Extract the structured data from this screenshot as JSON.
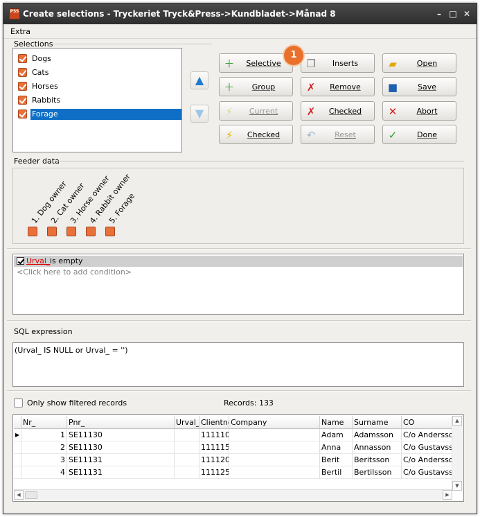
{
  "window": {
    "title": "Create selections - Tryckeriet Tryck&Press->Kundbladet->Månad 8",
    "icon": "pss-app-icon",
    "minimize": "–",
    "maximize": "□",
    "close": "✕"
  },
  "menu": {
    "extra": "Extra"
  },
  "selections": {
    "group_label": "Selections",
    "items": [
      {
        "label": "Dogs",
        "checked": true
      },
      {
        "label": "Cats",
        "checked": true
      },
      {
        "label": "Horses",
        "checked": true
      },
      {
        "label": "Rabbits",
        "checked": true
      },
      {
        "label": "Forage",
        "checked": true,
        "selected": true
      }
    ]
  },
  "buttons": {
    "selective": "Selective",
    "group": "Group",
    "current": "Current",
    "checked_left": "Checked",
    "inserts": "Inserts",
    "remove": "Remove",
    "checked_mid": "Checked",
    "reset": "Reset",
    "open": "Open",
    "save": "Save",
    "abort": "Abort",
    "done": "Done"
  },
  "badge": "1",
  "feeder": {
    "group_label": "Feeder data",
    "columns": [
      "1. Dog owner",
      "2. Cat owner",
      "3. Horse owner",
      "4. Rabbit owner",
      "5. Forage"
    ]
  },
  "filter": {
    "field": "Urval_",
    "condition": "is empty",
    "placeholder": "<Click here to add condition>"
  },
  "sql": {
    "label": "SQL expression",
    "expression": "(Urval_ IS NULL or Urval_ = '')"
  },
  "records": {
    "only_filtered_label": "Only show filtered records",
    "count_label": "Records: 133"
  },
  "grid": {
    "columns": [
      "Nr_",
      "Pnr_",
      "Urval_",
      "Clientno",
      "Company",
      "Name",
      "Surname",
      "CO"
    ],
    "rows": [
      [
        "1",
        "SE11130",
        "",
        "111110",
        "",
        "Adam",
        "Adamsson",
        "C/o Andersson"
      ],
      [
        "2",
        "SE11130",
        "",
        "111115",
        "",
        "Anna",
        "Annasson",
        "C/o Gustavsson"
      ],
      [
        "3",
        "SE11131",
        "",
        "111120",
        "",
        "Berit",
        "Beritsson",
        "C/o Andersson"
      ],
      [
        "4",
        "SE11131",
        "",
        "111125",
        "",
        "Bertil",
        "Bertilsson",
        "C/o Gustavsson"
      ]
    ]
  },
  "colors": {
    "accent": "#e8703a",
    "selection": "#0f6fc6",
    "titlebar": "#333333"
  }
}
